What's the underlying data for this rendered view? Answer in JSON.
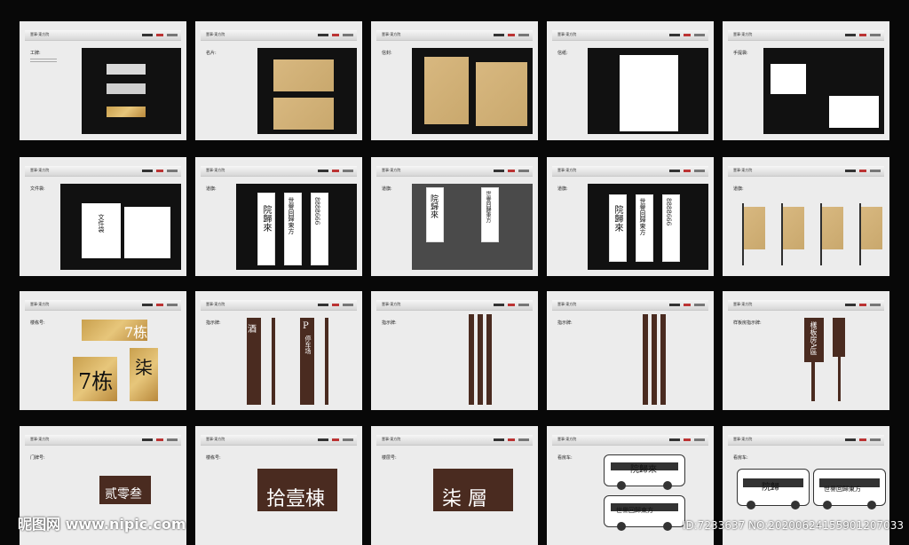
{
  "cards": {
    "c1": {
      "label": "工牌:",
      "brand": "壹事·東方院"
    },
    "c2": {
      "label": "名片:",
      "brand": "壹事·東方院"
    },
    "c3": {
      "label": "信封:",
      "brand": "壹事·東方院"
    },
    "c4": {
      "label": "信纸:",
      "brand": "壹事·東方院"
    },
    "c5": {
      "label": "手提袋:",
      "brand": "壹事·東方院"
    },
    "c6": {
      "label": "文件袋:",
      "brand": "壹事·東方院",
      "text": "文件袋"
    },
    "c7": {
      "label": "道旗:",
      "brand": "壹事·東方院",
      "b1": "院歸來",
      "b2": "世譽回歸東方",
      "b3": "8888666"
    },
    "c8": {
      "label": "道旗:",
      "brand": "壹事·東方院",
      "b1": "院歸來",
      "b2": "世譽回歸東方"
    },
    "c9": {
      "label": "道旗:",
      "brand": "壹事·東方院",
      "b1": "院歸來",
      "b2": "世譽回歸東方",
      "b3": "8888666"
    },
    "c10": {
      "label": "道旗:",
      "brand": "壹事·東方院"
    },
    "c11": {
      "label": "楼栋号:",
      "brand": "壹事·東方院",
      "a": "7栋",
      "b": "7栋",
      "c": "柒"
    },
    "c12": {
      "label": "指示牌:",
      "brand": "壹事·東方院",
      "a": "酒",
      "b": "P",
      "c": "停车场"
    },
    "c13": {
      "label": "指示牌:",
      "brand": "壹事·東方院"
    },
    "c14": {
      "label": "指示牌:",
      "brand": "壹事·東方院"
    },
    "c15": {
      "label": "样板房指示牌:",
      "brand": "壹事·東方院",
      "text": "樣板房A區"
    },
    "c16": {
      "label": "门牌号:",
      "brand": "壹事·東方院",
      "text": "贰零叁"
    },
    "c17": {
      "label": "楼栋号:",
      "brand": "壹事·東方院",
      "text": "拾壹棟"
    },
    "c18": {
      "label": "楼层号:",
      "brand": "壹事·東方院",
      "text": "柒 層"
    },
    "c19": {
      "label": "看房车:",
      "brand": "壹事·東方院",
      "a": "院歸來",
      "b": "世譽回歸東方"
    },
    "c20": {
      "label": "看房车:",
      "brand": "壹事·東方院",
      "a": "院歸",
      "b": "世譽回歸東方"
    }
  },
  "watermark": "昵图网 www.nipic.com",
  "idtag": "ID:7233637 NO:20200624155901207033"
}
